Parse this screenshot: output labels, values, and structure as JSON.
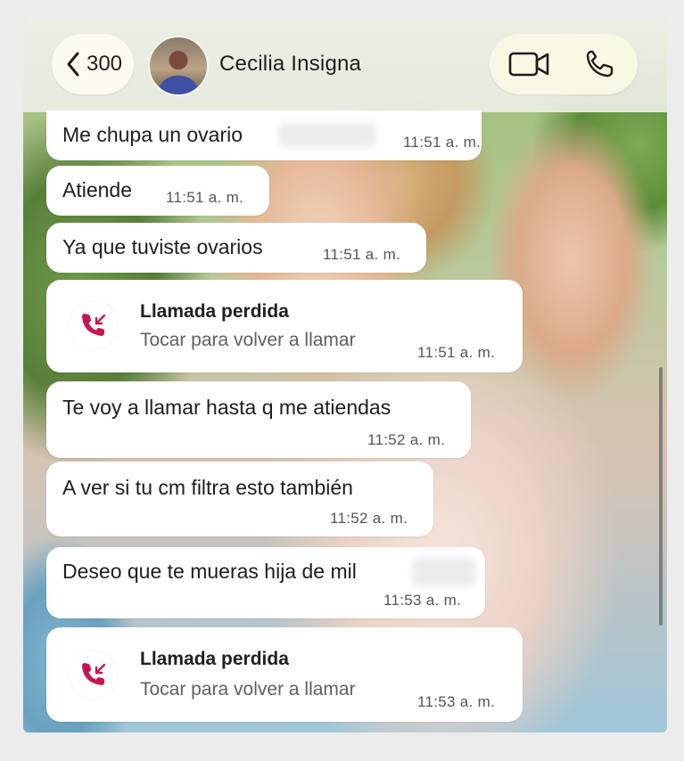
{
  "header": {
    "back_count": "300",
    "contact_name": "Cecilia Insigna",
    "video_icon": "video-camera-icon",
    "phone_icon": "phone-icon"
  },
  "messages": [
    {
      "type": "text",
      "text": "Me chupa un ovario",
      "time": "11:51 a. m."
    },
    {
      "type": "text",
      "text": "Atiende",
      "time": "11:51 a. m."
    },
    {
      "type": "text",
      "text": "Ya que tuviste ovarios",
      "time": "11:51 a. m."
    },
    {
      "type": "call",
      "title": "Llamada perdida",
      "subtitle": "Tocar para volver a llamar",
      "time": "11:51 a. m.",
      "icon": "missed-call-icon"
    },
    {
      "type": "text",
      "text": "Te voy a llamar hasta q me atiendas",
      "time": "11:52 a. m."
    },
    {
      "type": "text",
      "text": "A ver si tu cm filtra esto también",
      "time": "11:52 a. m."
    },
    {
      "type": "text",
      "text": "Deseo que te mueras hija de mil",
      "time": "11:53 a. m."
    },
    {
      "type": "call",
      "title": "Llamada perdida",
      "subtitle": "Tocar para volver a llamar",
      "time": "11:53 a. m.",
      "icon": "missed-call-icon"
    }
  ],
  "colors": {
    "missed_call": "#c8174e",
    "bubble": "#ffffff",
    "header_pill_call": "#f8f9e4"
  }
}
